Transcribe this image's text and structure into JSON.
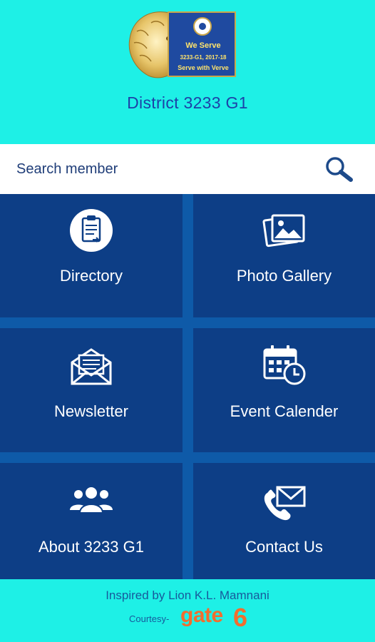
{
  "header": {
    "logo": {
      "line1": "We Serve",
      "line2": "3233-G1, 2017-18",
      "line3": "Serve with Verve"
    },
    "title": "District 3233 G1"
  },
  "search": {
    "placeholder": "Search member",
    "icon": "search-icon"
  },
  "menu": [
    {
      "label": "Directory",
      "icon": "clipboard-icon"
    },
    {
      "label": "Photo Gallery",
      "icon": "photos-icon"
    },
    {
      "label": "Newsletter",
      "icon": "envelope-letter-icon"
    },
    {
      "label": "Event Calender",
      "icon": "calendar-clock-icon"
    },
    {
      "label": "About 3233 G1",
      "icon": "group-icon"
    },
    {
      "label": "Contact Us",
      "icon": "phone-mail-icon"
    }
  ],
  "footer": {
    "inspired": "Inspired by Lion K.L. Mamnani",
    "courtesy": "Courtesy-",
    "brand_word": "gate",
    "brand_number": "6"
  },
  "colors": {
    "background": "#1ef0e6",
    "tile": "#0d3e86",
    "grid_gap": "#0e5aa8",
    "title": "#1d41a8",
    "brand": "#f26d2e"
  }
}
